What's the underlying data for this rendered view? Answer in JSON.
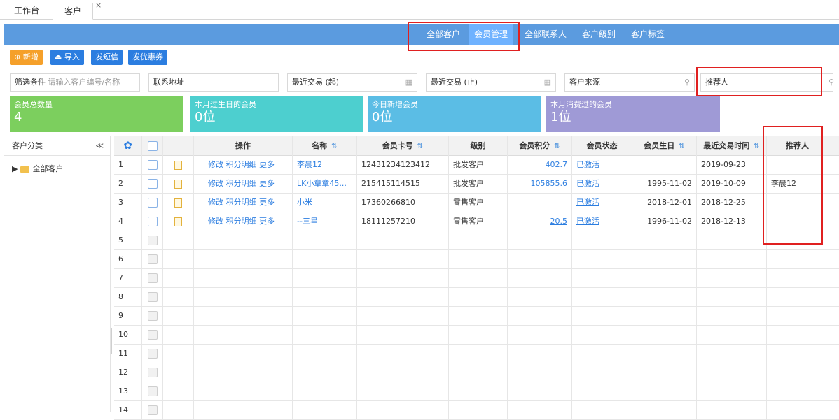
{
  "tabs": [
    {
      "label": "工作台"
    },
    {
      "label": "客户"
    }
  ],
  "tab_close": "×",
  "header_nav": [
    {
      "label": "全部客户"
    },
    {
      "label": "会员管理"
    },
    {
      "label": "全部联系人"
    },
    {
      "label": "客户级别"
    },
    {
      "label": "客户标签"
    }
  ],
  "toolbar": {
    "add": "新增",
    "import": "导入",
    "sms": "发短信",
    "coupon": "发优惠券"
  },
  "filters": {
    "condition_label": "筛选条件",
    "condition_placeholder": "请输入客户编号/名称",
    "address": "联系地址",
    "trade_start": "最近交易 (起)",
    "trade_end": "最近交易 (止)",
    "source": "客户来源",
    "referrer": "推荐人"
  },
  "cards": [
    {
      "title": "会员总数量",
      "value": "4",
      "color": "#7ccf5e"
    },
    {
      "title": "本月过生日的会员",
      "value": "0位",
      "color": "#4dcfcf"
    },
    {
      "title": "今日新增会员",
      "value": "0位",
      "color": "#5bbde5"
    },
    {
      "title": "本月消费过的会员",
      "value": "1位",
      "color": "#9f9ad6"
    }
  ],
  "sidebar": {
    "title": "客户分类",
    "collapse": "≪",
    "item": "全部客户"
  },
  "table": {
    "headers": {
      "op": "操作",
      "name": "名称",
      "card": "会员卡号",
      "level": "级别",
      "points": "会员积分",
      "status": "会员状态",
      "birthday": "会员生日",
      "last_trade": "最近交易时间",
      "referrer": "推荐人"
    },
    "op_labels": {
      "edit": "修改",
      "points_detail": "积分明细",
      "more": "更多"
    },
    "rows": [
      {
        "no": "1",
        "name": "李晨12",
        "card": "12431234123412",
        "level": "批发客户",
        "points": "402.7",
        "status": "已激活",
        "birthday": "",
        "last_trade": "2019-09-23",
        "referrer": ""
      },
      {
        "no": "2",
        "name": "LK小章章45...",
        "card": "215415114515",
        "level": "批发客户",
        "points": "105855.6",
        "status": "已激活",
        "birthday": "1995-11-02",
        "last_trade": "2019-10-09",
        "referrer": "李晨12"
      },
      {
        "no": "3",
        "name": "小米",
        "card": "17360266810",
        "level": "零售客户",
        "points": "",
        "status": "已激活",
        "birthday": "2018-12-01",
        "last_trade": "2018-12-25",
        "referrer": ""
      },
      {
        "no": "4",
        "name": "--三星",
        "card": "18111257210",
        "level": "零售客户",
        "points": "20.5",
        "status": "已激活",
        "birthday": "1996-11-02",
        "last_trade": "2018-12-13",
        "referrer": ""
      }
    ],
    "empty_rows": [
      "5",
      "6",
      "7",
      "8",
      "9",
      "10",
      "11",
      "12",
      "13",
      "14"
    ]
  }
}
